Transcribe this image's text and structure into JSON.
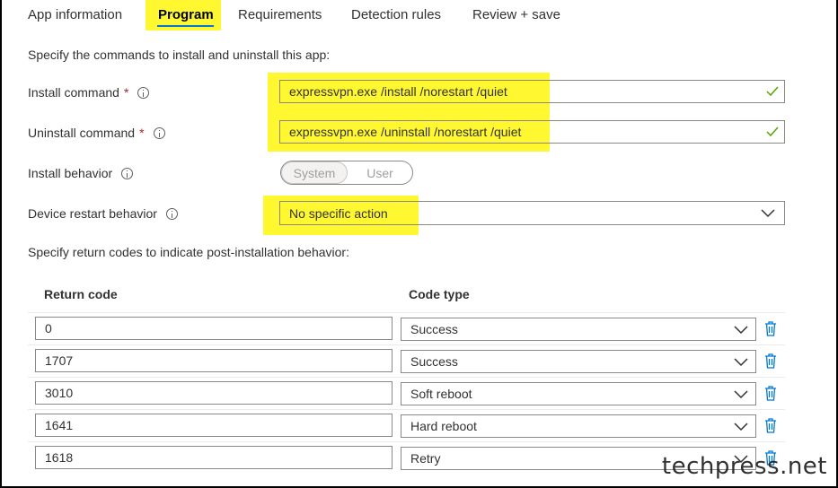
{
  "tabs": [
    {
      "label": "App information"
    },
    {
      "label": "Program",
      "active": true
    },
    {
      "label": "Requirements"
    },
    {
      "label": "Detection rules"
    },
    {
      "label": "Review + save"
    }
  ],
  "intro": "Specify the commands to install and uninstall this app:",
  "install_command": {
    "label": "Install command",
    "required": "*",
    "value": "expressvpn.exe /install /norestart /quiet"
  },
  "uninstall_command": {
    "label": "Uninstall command",
    "required": "*",
    "value": "expressvpn.exe /uninstall /norestart /quiet"
  },
  "install_behavior": {
    "label": "Install behavior",
    "options": [
      "System",
      "User"
    ],
    "selected": "System"
  },
  "device_restart": {
    "label": "Device restart behavior",
    "value": "No specific action"
  },
  "return_codes_intro": "Specify return codes to indicate post-installation behavior:",
  "return_codes": {
    "columns": [
      "Return code",
      "Code type"
    ],
    "rows": [
      {
        "code": "0",
        "type": "Success"
      },
      {
        "code": "1707",
        "type": "Success"
      },
      {
        "code": "3010",
        "type": "Soft reboot"
      },
      {
        "code": "1641",
        "type": "Hard reboot"
      },
      {
        "code": "1618",
        "type": "Retry"
      }
    ]
  },
  "watermark": "techpress.net",
  "colors": {
    "highlight": "#fff830",
    "accent": "#0078d4",
    "success": "#57a300",
    "required": "#a4262c"
  }
}
